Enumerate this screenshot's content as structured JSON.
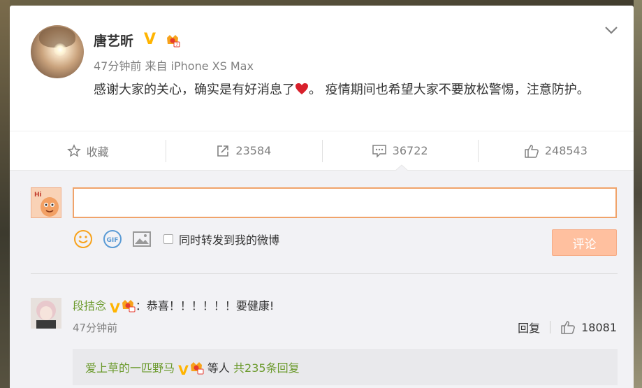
{
  "post": {
    "username": "唐艺昕",
    "timestamp": "47分钟前",
    "source": "来自 iPhone XS Max",
    "text_part1": "感谢大家的关心，确实是有好消息了",
    "text_part2": "。 疫情期间也希望大家不要放松警惕，注意防护。"
  },
  "actions": {
    "favorite": "收藏",
    "repost_count": "23584",
    "comment_count": "36722",
    "like_count": "248543"
  },
  "compose": {
    "input_value": "",
    "repost_label": "同时转发到我的微博",
    "submit_label": "评论"
  },
  "comment": {
    "username": "段拮念",
    "text": "：恭喜！！！！！！要健康!",
    "time": "47分钟前",
    "reply_label": "回复",
    "like_count": "18081",
    "reply_user": "爱上草的一匹野马",
    "reply_mid": "等人",
    "reply_count": "共235条回复"
  },
  "colors": {
    "accent_orange": "#f0a36a",
    "badge_gold": "#ffb400",
    "username_green": "#6b9a2c",
    "submit_disabled": "#ffc09f"
  }
}
